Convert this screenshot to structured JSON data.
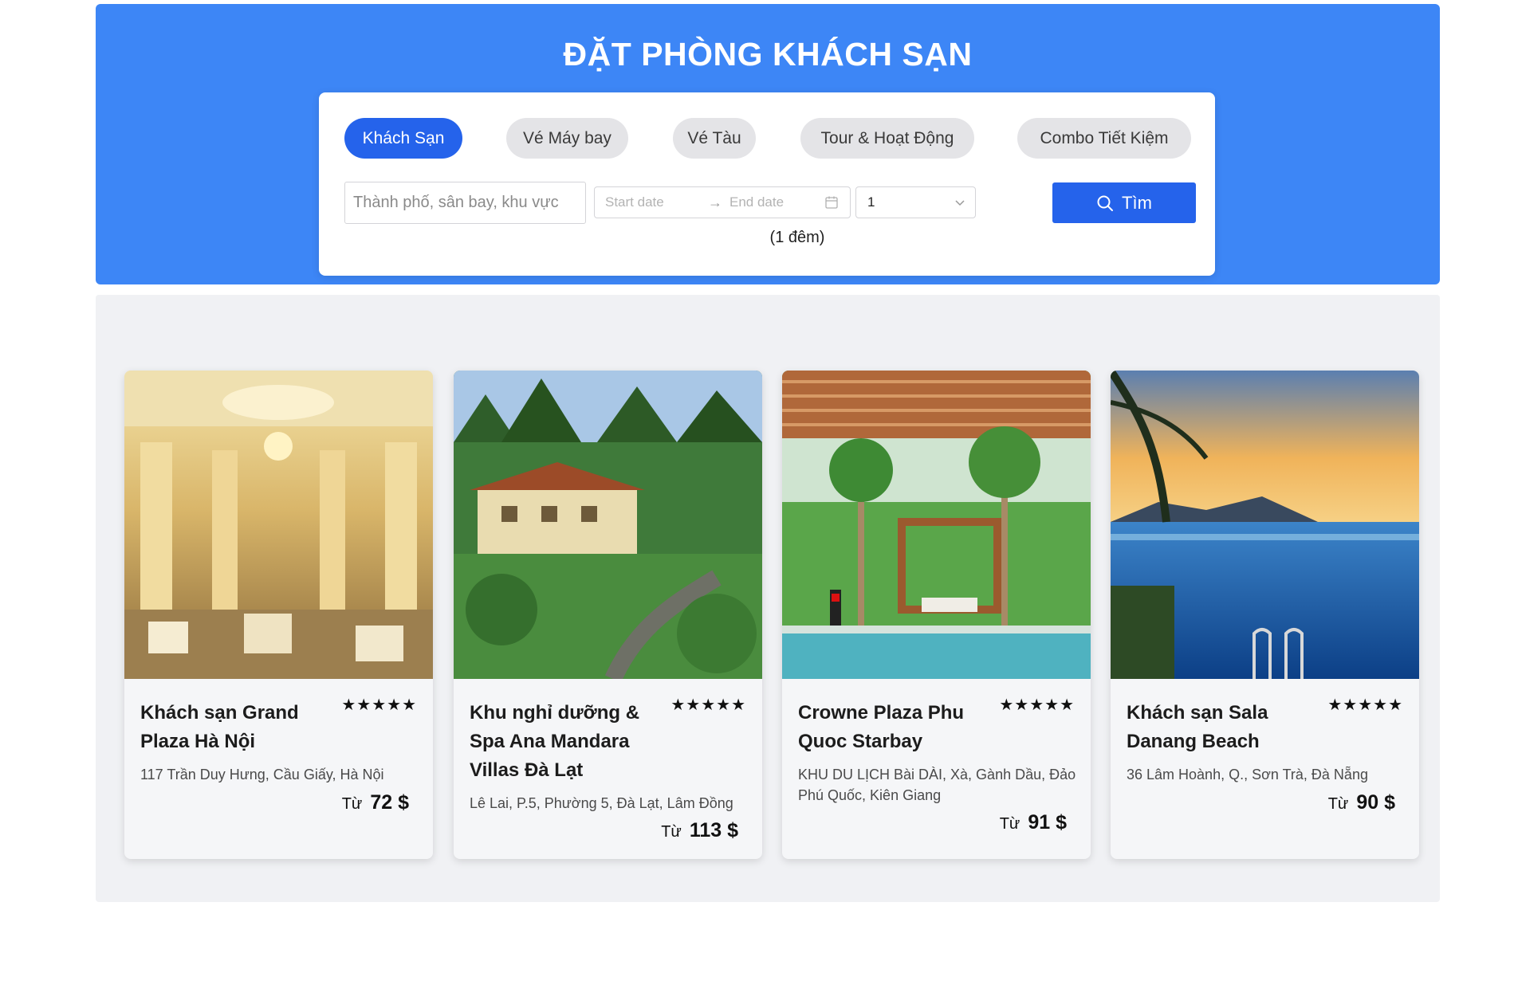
{
  "hero": {
    "title": "ĐẶT PHÒNG KHÁCH SẠN"
  },
  "tabs": [
    {
      "label": "Khách Sạn",
      "active": true
    },
    {
      "label": "Vé Máy bay",
      "active": false
    },
    {
      "label": "Vé Tàu",
      "active": false
    },
    {
      "label": "Tour & Hoạt Động",
      "active": false
    },
    {
      "label": "Combo Tiết Kiệm",
      "active": false
    }
  ],
  "search": {
    "destination_placeholder": "Thành phố, sân bay, khu vực",
    "start_placeholder": "Start date",
    "end_placeholder": "End date",
    "guests_value": "1",
    "nights_label": "(1 đêm)",
    "button_label": "Tìm"
  },
  "hotels": [
    {
      "name": "Khách sạn Grand Plaza Hà Nội",
      "rating": "★★★★★",
      "address": "117 Trần Duy Hưng, Cầu Giấy, Hà Nội",
      "price_prefix": "Từ",
      "price": "72 $"
    },
    {
      "name": "Khu nghỉ dưỡng & Spa Ana Mandara Villas Đà Lạt",
      "rating": "★★★★★",
      "address": "Lê Lai, P.5, Phường 5, Đà Lạt, Lâm Đồng",
      "price_prefix": "Từ",
      "price": "113 $"
    },
    {
      "name": "Crowne Plaza Phu Quoc Starbay",
      "rating": "★★★★★",
      "address": "KHU DU LỊCH Bài DÀI, Xà, Gành Dầu, Đảo Phú Quốc, Kiên Giang",
      "price_prefix": "Từ",
      "price": "91 $"
    },
    {
      "name": "Khách sạn Sala Danang Beach",
      "rating": "★★★★★",
      "address": "36 Lâm Hoành, Q., Sơn Trà, Đà Nẵng",
      "price_prefix": "Từ",
      "price": "90 $"
    }
  ],
  "colors": {
    "primary": "#2563eb",
    "hero_bg": "#3d86f6",
    "section_bg": "#f0f1f4"
  }
}
